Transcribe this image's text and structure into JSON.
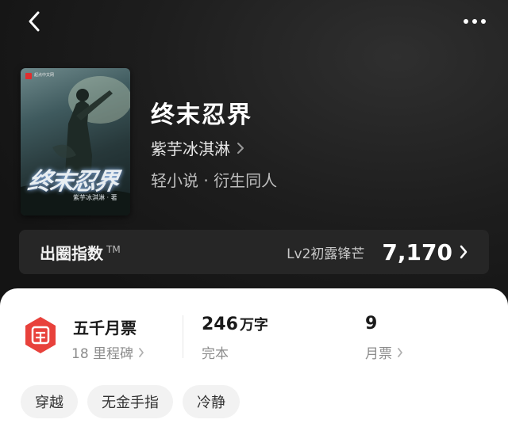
{
  "book": {
    "title": "终末忍界",
    "author": "紫芋冰淇淋",
    "genre": "轻小说 · 衍生同人",
    "cover": {
      "badge_text": "起点中文网",
      "title_text": "终末忍界",
      "author_text": "紫芋冰淇淋 · 著"
    }
  },
  "index": {
    "label": "出圈指数",
    "tm": "TM",
    "level": "Lv2初露锋芒",
    "value": "7,170"
  },
  "stats": {
    "monthly_title": "五千月票",
    "milestones": "18 里程碑",
    "word_count": "246",
    "word_unit": "万字",
    "status": "完本",
    "votes": "9",
    "votes_label": "月票"
  },
  "tags": [
    "穿越",
    "无金手指",
    "冷静"
  ],
  "icons": {
    "back": "chevron-left-icon",
    "more": "more-dots-icon",
    "ticket": "ticket-icon"
  },
  "colors": {
    "accent": "#e8413b",
    "bg_dark": "#141414",
    "card": "#ffffff"
  }
}
